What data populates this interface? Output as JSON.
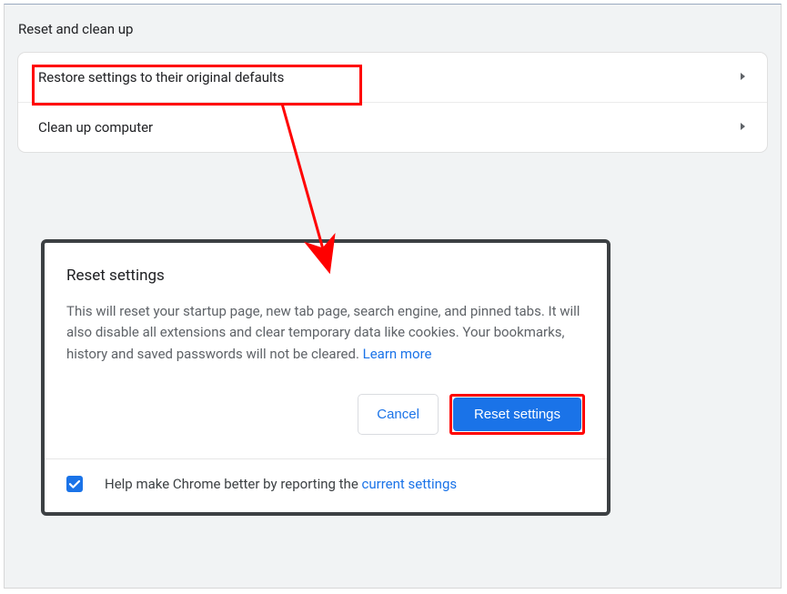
{
  "section": {
    "title": "Reset and clean up",
    "rows": [
      {
        "label": "Restore settings to their original defaults"
      },
      {
        "label": "Clean up computer"
      }
    ]
  },
  "dialog": {
    "title": "Reset settings",
    "body_prefix": "This will reset your startup page, new tab page, search engine, and pinned tabs. It will also disable all extensions and clear temporary data like cookies. Your bookmarks, history and saved passwords will not be cleared. ",
    "learn_more": "Learn more",
    "cancel": "Cancel",
    "confirm": "Reset settings",
    "footer_prefix": "Help make Chrome better by reporting the ",
    "footer_link": "current settings",
    "checkbox_checked": true
  },
  "colors": {
    "accent": "#1a73e8",
    "highlight": "#ff0000"
  }
}
